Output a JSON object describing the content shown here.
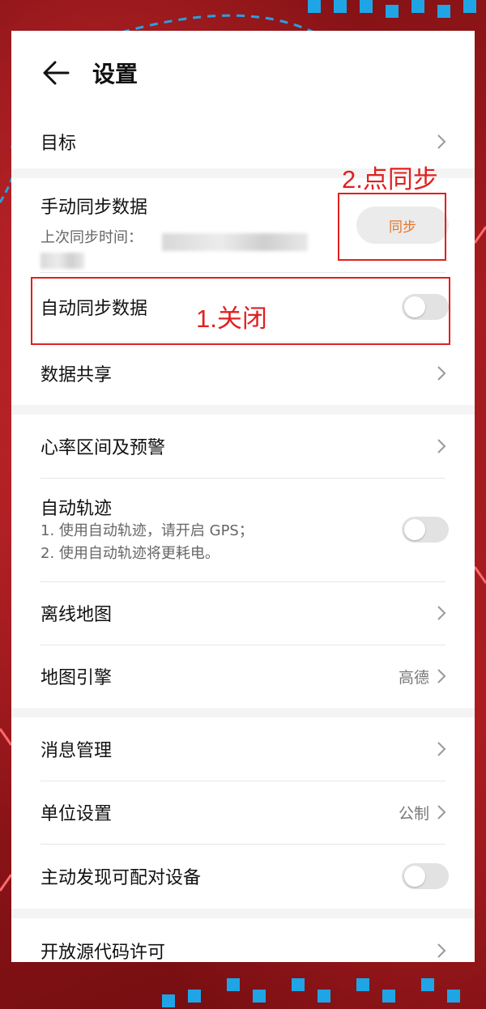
{
  "header": {
    "title": "设置",
    "back_icon": "back-arrow-icon"
  },
  "rows": {
    "goal": {
      "label": "目标"
    },
    "manual_sync": {
      "label": "手动同步数据",
      "sub_prefix": "上次同步时间：",
      "button_label": "同步"
    },
    "auto_sync": {
      "label": "自动同步数据",
      "toggle_on": false
    },
    "data_share": {
      "label": "数据共享"
    },
    "heart_rate": {
      "label": "心率区间及预警"
    },
    "auto_track": {
      "label": "自动轨迹",
      "sub1": "1. 使用自动轨迹，请开启 GPS；",
      "sub2": "2. 使用自动轨迹将更耗电。",
      "toggle_on": false
    },
    "offline_map": {
      "label": "离线地图"
    },
    "map_engine": {
      "label": "地图引擎",
      "value": "高德"
    },
    "messages": {
      "label": "消息管理"
    },
    "units": {
      "label": "单位设置",
      "value": "公制"
    },
    "discover": {
      "label": "主动发现可配对设备",
      "toggle_on": false
    },
    "open_source": {
      "label": "开放源代码许可"
    }
  },
  "annotations": {
    "step1": "1.关闭",
    "step2": "2.点同步",
    "color": "#e02020"
  },
  "colors": {
    "accent": "#e5762b",
    "toggle_off": "#e2e2e2",
    "panel_bg": "#f4f4f4"
  }
}
